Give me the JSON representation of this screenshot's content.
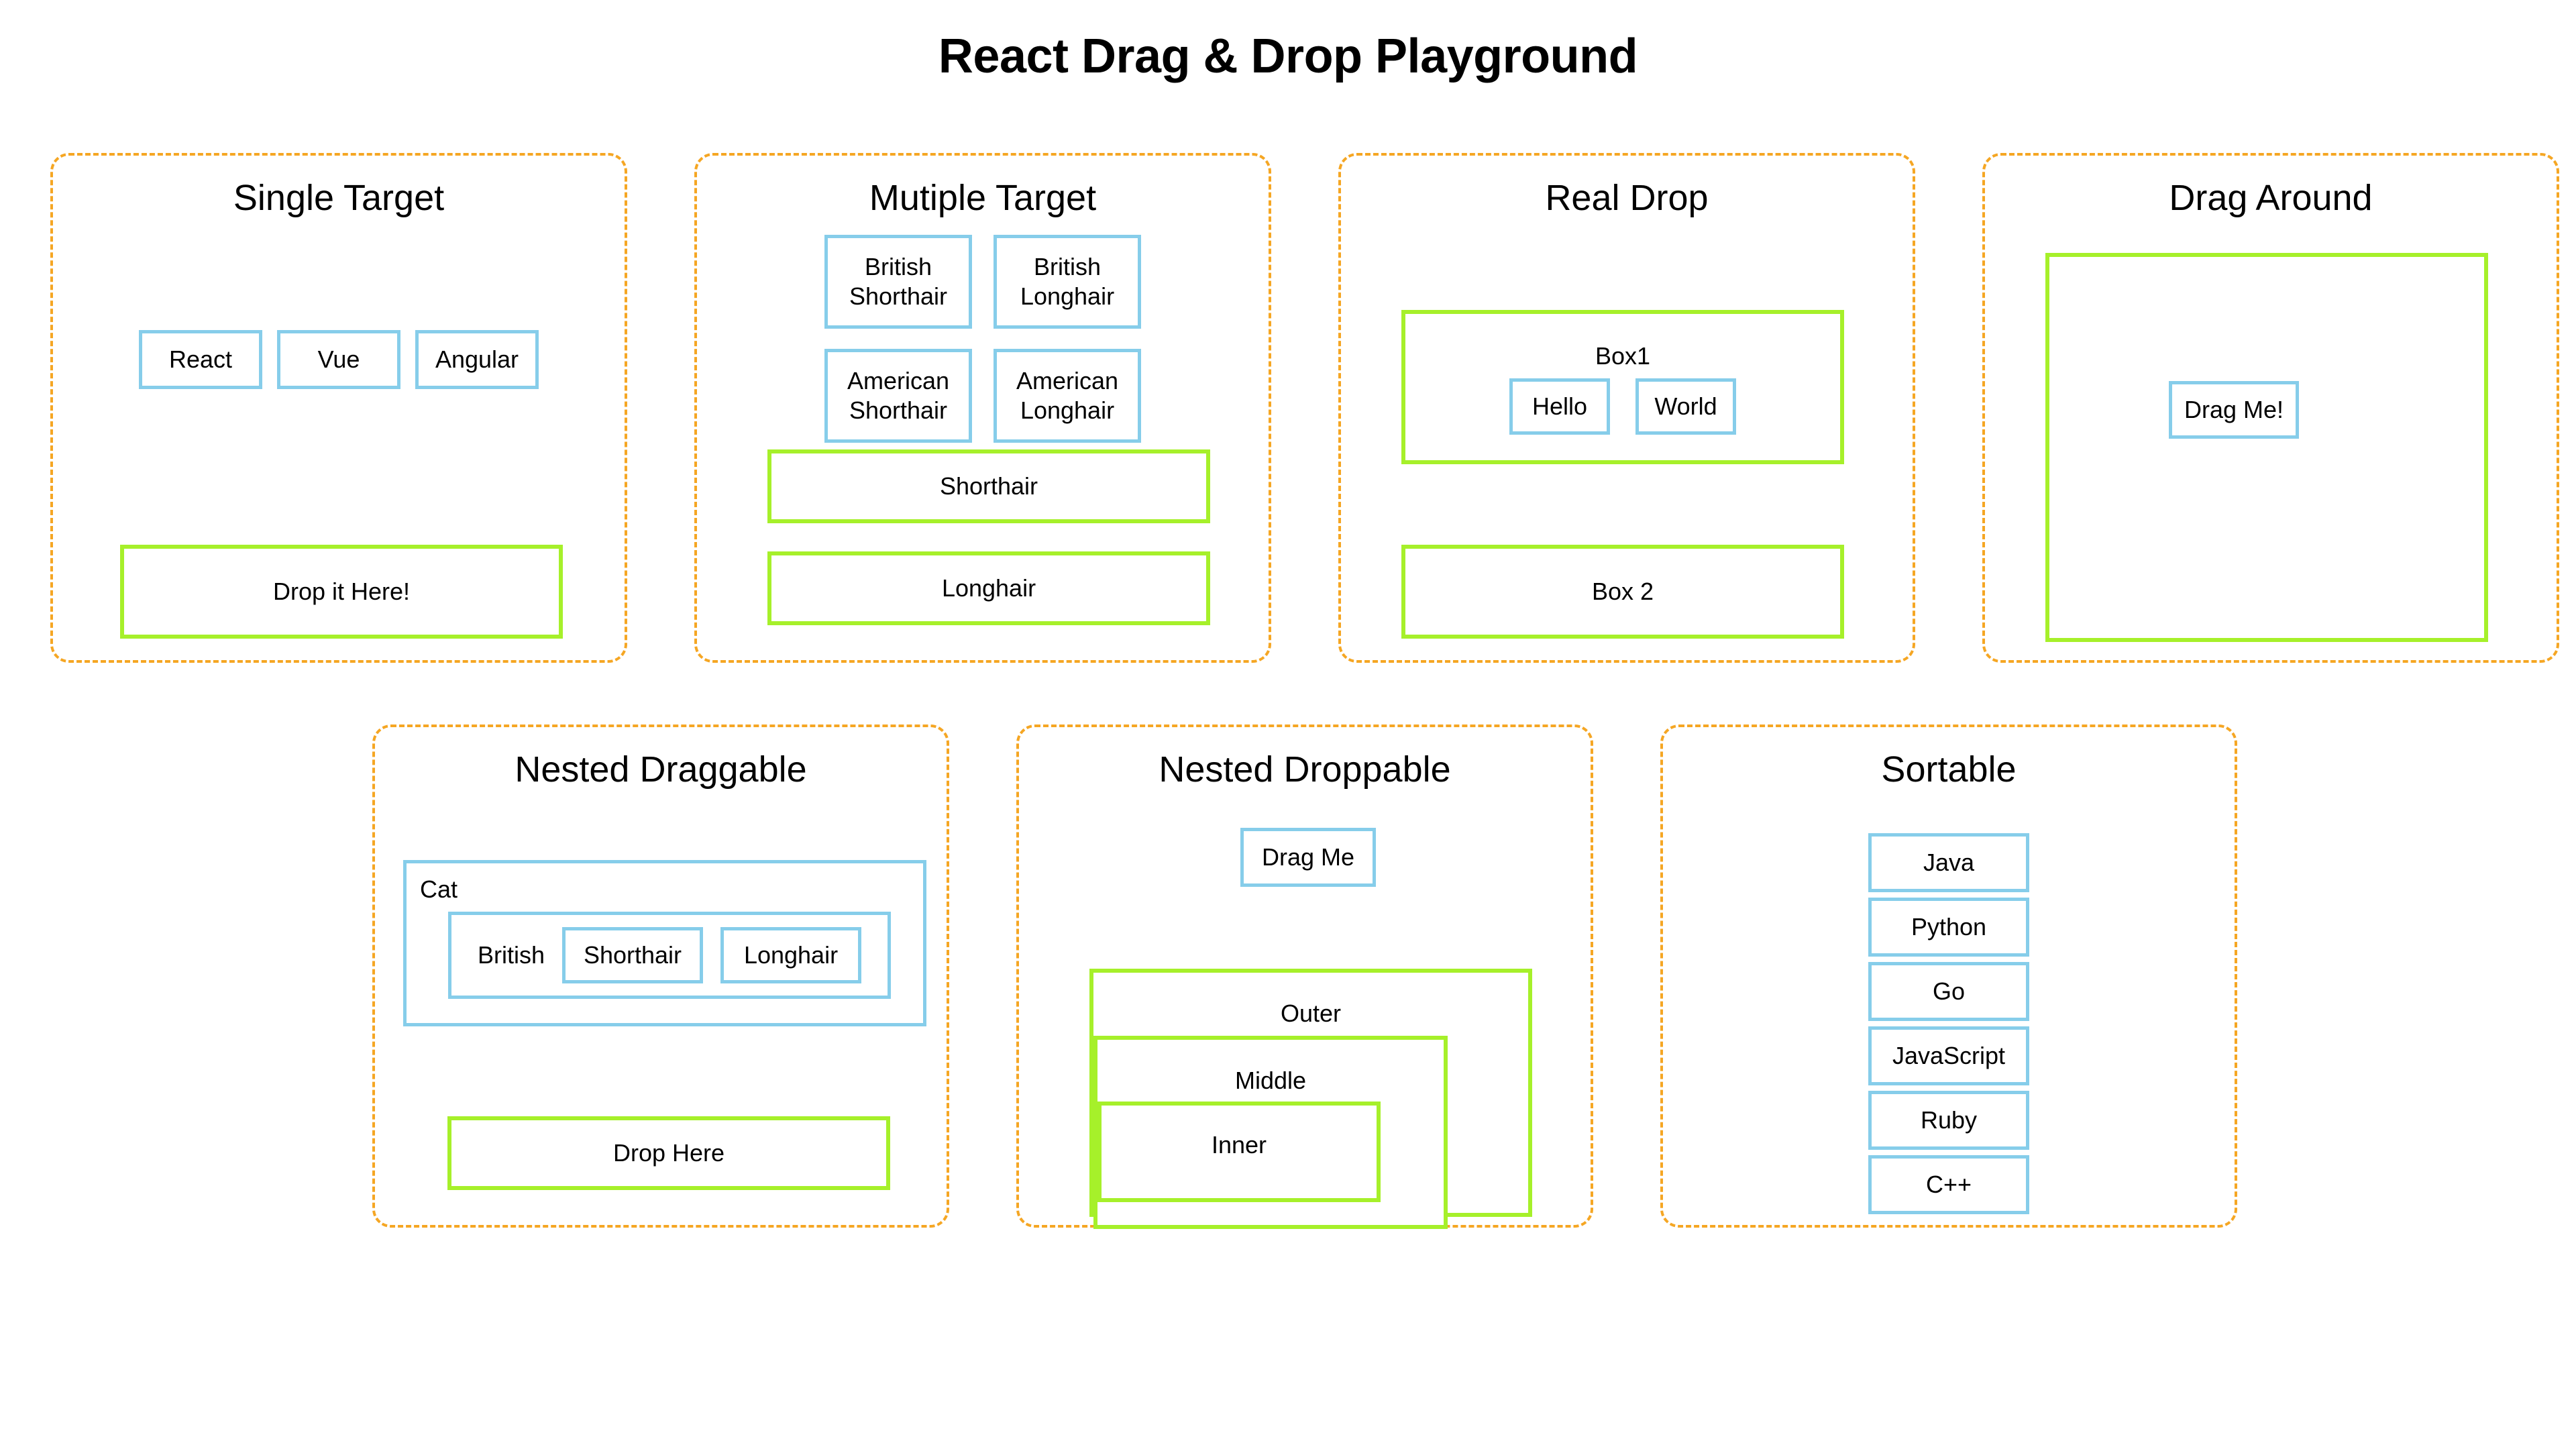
{
  "page": {
    "title": "React Drag & Drop Playground"
  },
  "colors": {
    "panel_border": "#f5a623",
    "draggable_border": "#86cdea",
    "droppable_border": "#a6f02a",
    "background": "#ffffff",
    "text": "#000000"
  },
  "panels": {
    "single_target": {
      "title": "Single Target",
      "draggables": [
        "React",
        "Vue",
        "Angular"
      ],
      "droppable": "Drop it Here!"
    },
    "multiple_target": {
      "title": "Mutiple Target",
      "draggables_row1": [
        "British\nShorthair",
        "British\nLonghair"
      ],
      "draggables_row2": [
        "American\nShorthair",
        "American\nLonghair"
      ],
      "draggable_1": "British Shorthair",
      "draggable_2": "British Longhair",
      "draggable_3": "American Shorthair",
      "draggable_4": "American Longhair",
      "droppable_1": "Shorthair",
      "droppable_2": "Longhair"
    },
    "real_drop": {
      "title": "Real Drop",
      "box1_label": "Box1",
      "box1_items": [
        "Hello",
        "World"
      ],
      "item_hello": "Hello",
      "item_world": "World",
      "box2_label": "Box 2"
    },
    "drag_around": {
      "title": "Drag Around",
      "draggable": "Drag Me!"
    },
    "nested_draggable": {
      "title": "Nested Draggable",
      "cat_label": "Cat",
      "british_label": "British",
      "shorthair_label": "Shorthair",
      "longhair_label": "Longhair",
      "droppable": "Drop Here"
    },
    "nested_droppable": {
      "title": "Nested Droppable",
      "draggable": "Drag Me",
      "outer_label": "Outer",
      "middle_label": "Middle",
      "inner_label": "Inner"
    },
    "sortable": {
      "title": "Sortable",
      "items": [
        "Java",
        "Python",
        "Go",
        "JavaScript",
        "Ruby",
        "C++"
      ]
    }
  }
}
